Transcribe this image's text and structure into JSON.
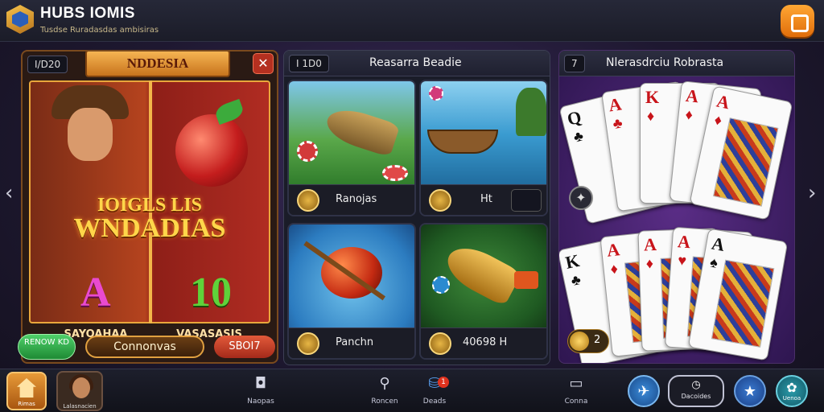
{
  "app": {
    "title": "HUBS IOMIS",
    "subtitle": "Tusdse Ruradasdas ambisiras"
  },
  "panels": {
    "slot": {
      "count": "I/D20",
      "title": "NDDESIA",
      "close": "✕",
      "headline_1": "IOIGLS LIS",
      "headline_2": "WNDADIAS",
      "symbol_a": "A",
      "symbol_10": "10",
      "symbol_a_label": "SAYOAHAA",
      "symbol_10_label": "VASASASIS",
      "btn_green": "RENOW KD",
      "btn_continue": "Connonvas",
      "btn_red": "SBOI7"
    },
    "fishing": {
      "count": "I 1D0",
      "title": "Reasarra Beadie",
      "tiles": [
        {
          "label": "Ranojas"
        },
        {
          "label": "Ht"
        },
        {
          "label": "Panchn"
        },
        {
          "label": "40698 H"
        }
      ]
    },
    "cards": {
      "count": "7",
      "title": "Nlerasdrciu Robrasta",
      "coin_value": "2"
    }
  },
  "bottom_nav": {
    "home_label": "Rimas",
    "avatar_label": "Lalasnacien",
    "items": [
      {
        "label": "Naopas",
        "icon": "camera-icon"
      },
      {
        "label": "Roncen",
        "icon": "search-icon"
      },
      {
        "label": "Deads",
        "icon": "chips-icon"
      },
      {
        "label": "Conna",
        "icon": "monitor-icon"
      }
    ],
    "badge": "1",
    "pill_label": "Dacoides",
    "right_label": "Uenoa"
  },
  "nav_arrows": {
    "left": "‹",
    "right": "›"
  }
}
